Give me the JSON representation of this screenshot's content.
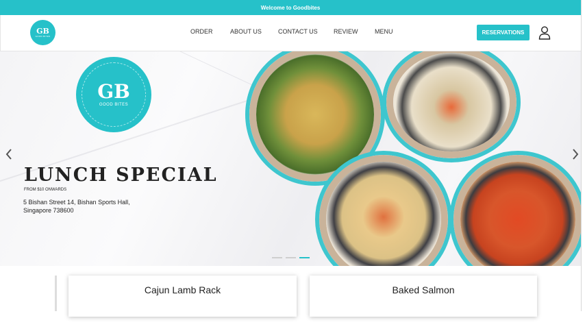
{
  "topbar": {
    "message": "Welcome to Goodbites"
  },
  "brand": {
    "initials": "GB",
    "name": "GOOD BITES",
    "tagline": "FOOD MADE HEALTHY & DELICIOUS"
  },
  "nav": [
    {
      "label": "ORDER"
    },
    {
      "label": "ABOUT US"
    },
    {
      "label": "CONTACT US"
    },
    {
      "label": "REVIEW"
    },
    {
      "label": "MENU"
    }
  ],
  "header": {
    "reservations_label": "RESERVATIONS",
    "user_icon": "user-icon"
  },
  "hero": {
    "headline": "LUNCH SPECIAL",
    "price_note": "FROM $10 ONWARDS",
    "address_line1": "5 Bishan Street 14, Bishan Sports Hall,",
    "address_line2": "Singapore 738600",
    "slides": 3,
    "active_slide": 3,
    "prev_icon": "chevron-left-icon",
    "next_icon": "chevron-right-icon"
  },
  "cards": [
    {
      "title": "Cajun Lamb Rack"
    },
    {
      "title": "Baked Salmon"
    }
  ],
  "colors": {
    "accent": "#26c1c9",
    "text": "#222222",
    "plate_rim": "#3ec6ce"
  }
}
